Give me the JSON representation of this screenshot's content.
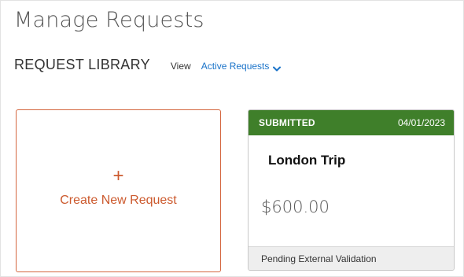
{
  "page": {
    "title": "Manage Requests"
  },
  "library": {
    "title": "REQUEST LIBRARY",
    "view_label": "View",
    "view_selected": "Active Requests",
    "view_icon": "chevron-down-icon"
  },
  "create_card": {
    "icon": "+",
    "label": "Create New Request",
    "color": "#cc5a2e"
  },
  "request_card": {
    "status": "SUBMITTED",
    "date": "04/01/2023",
    "name": "London Trip",
    "amount": "$600.00",
    "footer_status": "Pending External Validation",
    "header_color": "#3f7f2a"
  },
  "colors": {
    "link": "#1a73c9",
    "accent": "#cc5a2e",
    "status_green": "#3f7f2a"
  }
}
